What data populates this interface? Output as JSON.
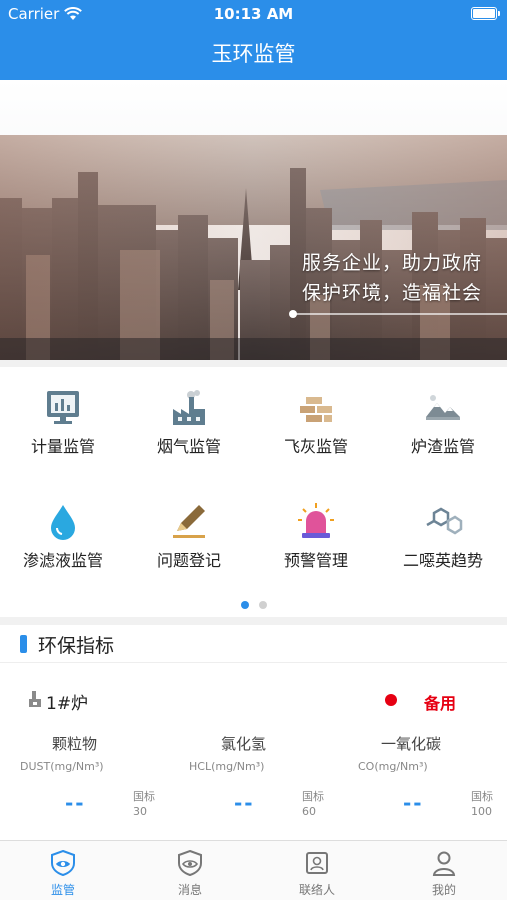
{
  "status_bar": {
    "carrier": "Carrier",
    "time": "10:13 AM",
    "battery_level": 1.0,
    "icons": [
      "wifi-icon",
      "battery-icon"
    ]
  },
  "nav": {
    "title": "玉环监管"
  },
  "banner": {
    "line1": "服务企业，助力政府",
    "line2": "保护环境，造福社会"
  },
  "menu": {
    "items": [
      {
        "label": "计量监管",
        "icon": "monitor-chart-icon"
      },
      {
        "label": "烟气监管",
        "icon": "factory-smoke-icon"
      },
      {
        "label": "飞灰监管",
        "icon": "bricks-icon"
      },
      {
        "label": "炉渣监管",
        "icon": "mountain-slag-icon"
      },
      {
        "label": "渗滤液监管",
        "icon": "water-drop-icon"
      },
      {
        "label": "问题登记",
        "icon": "pencil-icon"
      },
      {
        "label": "预警管理",
        "icon": "alarm-light-icon"
      },
      {
        "label": "二噁英趋势",
        "icon": "molecule-icon"
      }
    ],
    "page_count": 2,
    "current_page": 1
  },
  "indicators": {
    "title": "环保指标",
    "furnace": {
      "name": "1#炉",
      "status": "备用",
      "status_color": "#e60012"
    },
    "metrics": [
      {
        "name": "颗粒物",
        "unit": "DUST(mg/Nm³)",
        "value": "--",
        "std_label": "国标",
        "std_value": "30"
      },
      {
        "name": "氯化氢",
        "unit": "HCL(mg/Nm³)",
        "value": "--",
        "std_label": "国标",
        "std_value": "60"
      },
      {
        "name": "一氧化碳",
        "unit": "CO(mg/Nm³)",
        "value": "--",
        "std_label": "国标",
        "std_value": "100"
      }
    ]
  },
  "tabbar": {
    "tabs": [
      {
        "label": "监管",
        "icon": "eye-shield-icon",
        "active": true
      },
      {
        "label": "消息",
        "icon": "message-shield-icon",
        "active": false
      },
      {
        "label": "联络人",
        "icon": "contact-card-icon",
        "active": false
      },
      {
        "label": "我的",
        "icon": "person-icon",
        "active": false
      }
    ]
  },
  "colors": {
    "brand": "#2b8ee9",
    "alert": "#e60012"
  }
}
